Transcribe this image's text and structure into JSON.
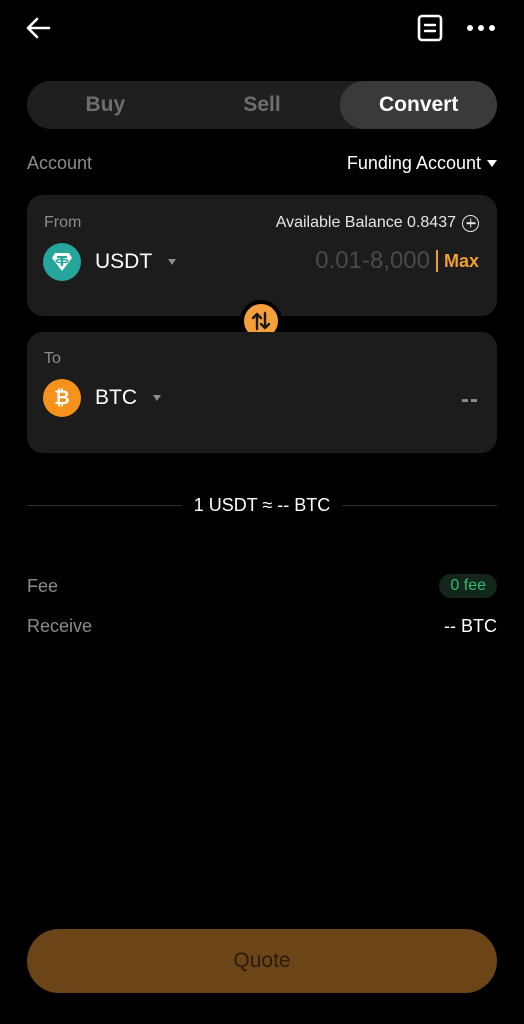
{
  "tabs": [
    {
      "label": "Buy",
      "active": false
    },
    {
      "label": "Sell",
      "active": false
    },
    {
      "label": "Convert",
      "active": true
    }
  ],
  "account": {
    "label": "Account",
    "value": "Funding Account"
  },
  "from": {
    "label": "From",
    "balance_label": "Available Balance 0.8437",
    "coin": "USDT",
    "coin_icon": "tether-icon",
    "amount_placeholder": "0.01-8,000",
    "max_label": "Max"
  },
  "to": {
    "label": "To",
    "coin": "BTC",
    "coin_icon": "bitcoin-icon",
    "value": "--"
  },
  "rate": {
    "text": "1 USDT ≈ -- BTC"
  },
  "fee": {
    "label": "Fee",
    "value": "0 fee"
  },
  "receive": {
    "label": "Receive",
    "value": "-- BTC"
  },
  "quote_button": {
    "label": "Quote"
  },
  "colors": {
    "accent": "#f5a03a",
    "fee_green": "#2ebd6f",
    "usdt": "#26a69a",
    "btc": "#f7931a",
    "quote_bg": "#6b4518"
  }
}
